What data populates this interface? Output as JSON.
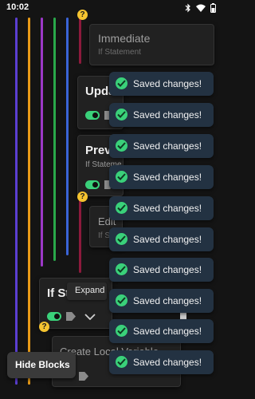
{
  "status_bar": {
    "time": "10:02"
  },
  "blocks": {
    "immediate": {
      "title": "Immediate",
      "subtitle": "If Statement"
    },
    "update": {
      "title": "Upda"
    },
    "preview": {
      "title": "Previ",
      "subtitle": "If Stateme"
    },
    "edit": {
      "title": "Edit",
      "subtitle": "If S"
    },
    "if_statement": {
      "title": "If St"
    },
    "create_local": {
      "title": "Create Local Variable"
    }
  },
  "tooltip": {
    "label": "Expand"
  },
  "toasts": [
    {
      "message": "Saved changes!"
    },
    {
      "message": "Saved changes!"
    },
    {
      "message": "Saved changes!"
    },
    {
      "message": "Saved changes!"
    },
    {
      "message": "Saved changes!"
    },
    {
      "message": "Saved changes!"
    },
    {
      "message": "Saved changes!"
    },
    {
      "message": "Saved changes!"
    },
    {
      "message": "Saved changes!"
    },
    {
      "message": "Saved changes!"
    }
  ],
  "hide_blocks_label": "Hide Blocks",
  "colors": {
    "background": "#141414",
    "toast": "#233242",
    "success": "#3ad17a",
    "warning": "#f5c430",
    "line_purple": "#5b3fd1",
    "line_orange": "#e89a17",
    "line_violet": "#9c38c8",
    "line_green": "#29a84a",
    "line_blue": "#3a64d8",
    "line_maroon": "#8c1a3c"
  }
}
